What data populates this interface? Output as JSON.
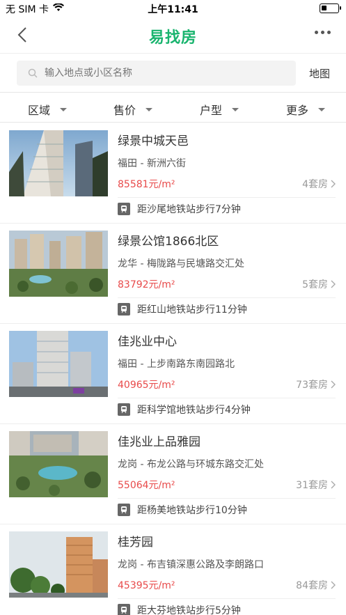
{
  "status": {
    "carrier": "无 SIM 卡",
    "time": "上午11:41",
    "battery_level": 0.35
  },
  "nav": {
    "title": "易找房"
  },
  "search": {
    "placeholder": "输入地点或小区名称",
    "map_label": "地图"
  },
  "filters": [
    {
      "label": "区域"
    },
    {
      "label": "售价"
    },
    {
      "label": "户型"
    },
    {
      "label": "更多"
    }
  ],
  "listings": [
    {
      "name": "绿景中城天邑",
      "location": "福田 - 新洲六街",
      "price": "85581元/m²",
      "count": "4套房",
      "metro": "距沙尾地铁站步行7分钟"
    },
    {
      "name": "绿景公馆1866北区",
      "location": "龙华 - 梅陇路与民塘路交汇处",
      "price": "83792元/m²",
      "count": "5套房",
      "metro": "距红山地铁站步行11分钟"
    },
    {
      "name": "佳兆业中心",
      "location": "福田 - 上步南路东南园路北",
      "price": "40965元/m²",
      "count": "73套房",
      "metro": "距科学馆地铁站步行4分钟"
    },
    {
      "name": "佳兆业上品雅园",
      "location": "龙岗 - 布龙公路与环城东路交汇处",
      "price": "55064元/m²",
      "count": "31套房",
      "metro": "距杨美地铁站步行10分钟"
    },
    {
      "name": "桂芳园",
      "location": "龙岗 - 布吉镇深惠公路及李朗路口",
      "price": "45395元/m²",
      "count": "84套房",
      "metro": "距大芬地铁站步行5分钟"
    }
  ]
}
